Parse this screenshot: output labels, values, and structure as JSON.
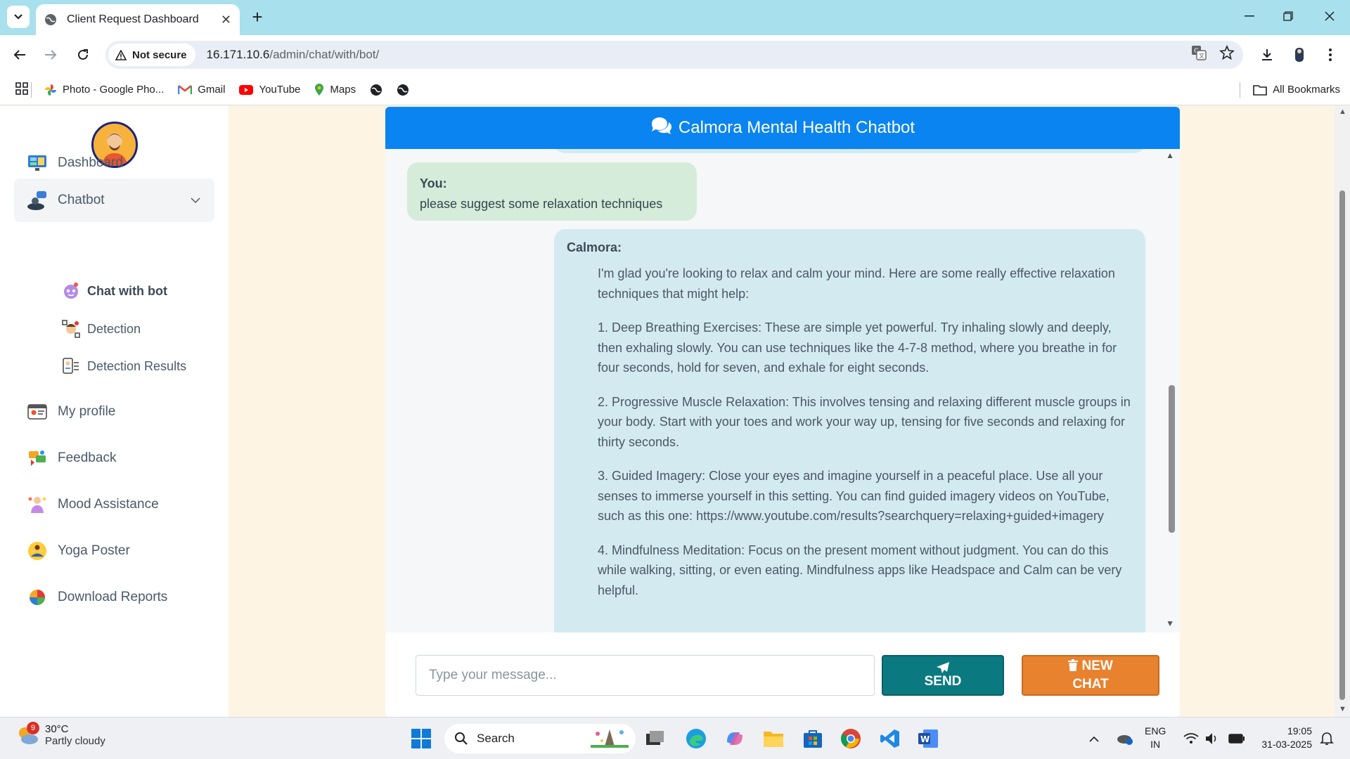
{
  "browser": {
    "tab_title": "Client Request Dashboard",
    "security_label": "Not secure",
    "url_host": "16.171.10.6",
    "url_path": "/admin/chat/with/bot/",
    "bookmarks": [
      "Photo - Google Pho...",
      "Gmail",
      "YouTube",
      "Maps"
    ],
    "all_bookmarks": "All Bookmarks"
  },
  "sidebar": {
    "items": [
      {
        "label": "Dashboard",
        "icon": "dashboard-icon"
      },
      {
        "label": "Chatbot",
        "icon": "chatbot-icon"
      },
      {
        "label": "My profile",
        "icon": "profile-icon"
      },
      {
        "label": "Feedback",
        "icon": "feedback-icon"
      },
      {
        "label": "Mood Assistance",
        "icon": "mood-icon"
      },
      {
        "label": "Yoga Poster",
        "icon": "yoga-icon"
      },
      {
        "label": "Download Reports",
        "icon": "reports-icon"
      }
    ],
    "subitems": [
      {
        "label": "Chat with bot",
        "icon": "bot-icon"
      },
      {
        "label": "Detection",
        "icon": "detection-icon"
      },
      {
        "label": "Detection Results",
        "icon": "results-icon"
      }
    ]
  },
  "chat": {
    "title": "Calmora Mental Health Chatbot",
    "user_label": "You:",
    "user_message": "please suggest some relaxation techniques",
    "bot_label": "Calmora:",
    "bot_paragraphs": [
      "I'm glad you're looking to relax and calm your mind. Here are some really effective relaxation techniques that might help:",
      "1. Deep Breathing Exercises: These are simple yet powerful. Try inhaling slowly and deeply, then exhaling slowly. You can use techniques like the 4-7-8 method, where you breathe in for four seconds, hold for seven, and exhale for eight seconds.",
      "2. Progressive Muscle Relaxation: This involves tensing and relaxing different muscle groups in your body. Start with your toes and work your way up, tensing for five seconds and relaxing for thirty seconds.",
      "3. Guided Imagery: Close your eyes and imagine yourself in a peaceful place. Use all your senses to immerse yourself in this setting. You can find guided imagery videos on YouTube, such as this one: https://www.youtube.com/results?searchquery=relaxing+guided+imagery",
      "4. Mindfulness Meditation: Focus on the present moment without judgment. You can do this while walking, sitting, or even eating. Mindfulness apps like Headspace and Calm can be very helpful."
    ],
    "input_placeholder": "Type your message...",
    "send_label": "SEND",
    "new_chat_label_1": "NEW",
    "new_chat_label_2": "CHAT"
  },
  "taskbar": {
    "temperature": "30°C",
    "condition": "Partly cloudy",
    "weather_badge": "9",
    "search_label": "Search",
    "language": "ENG",
    "region": "IN",
    "time": "19:05",
    "date": "31-03-2025"
  }
}
